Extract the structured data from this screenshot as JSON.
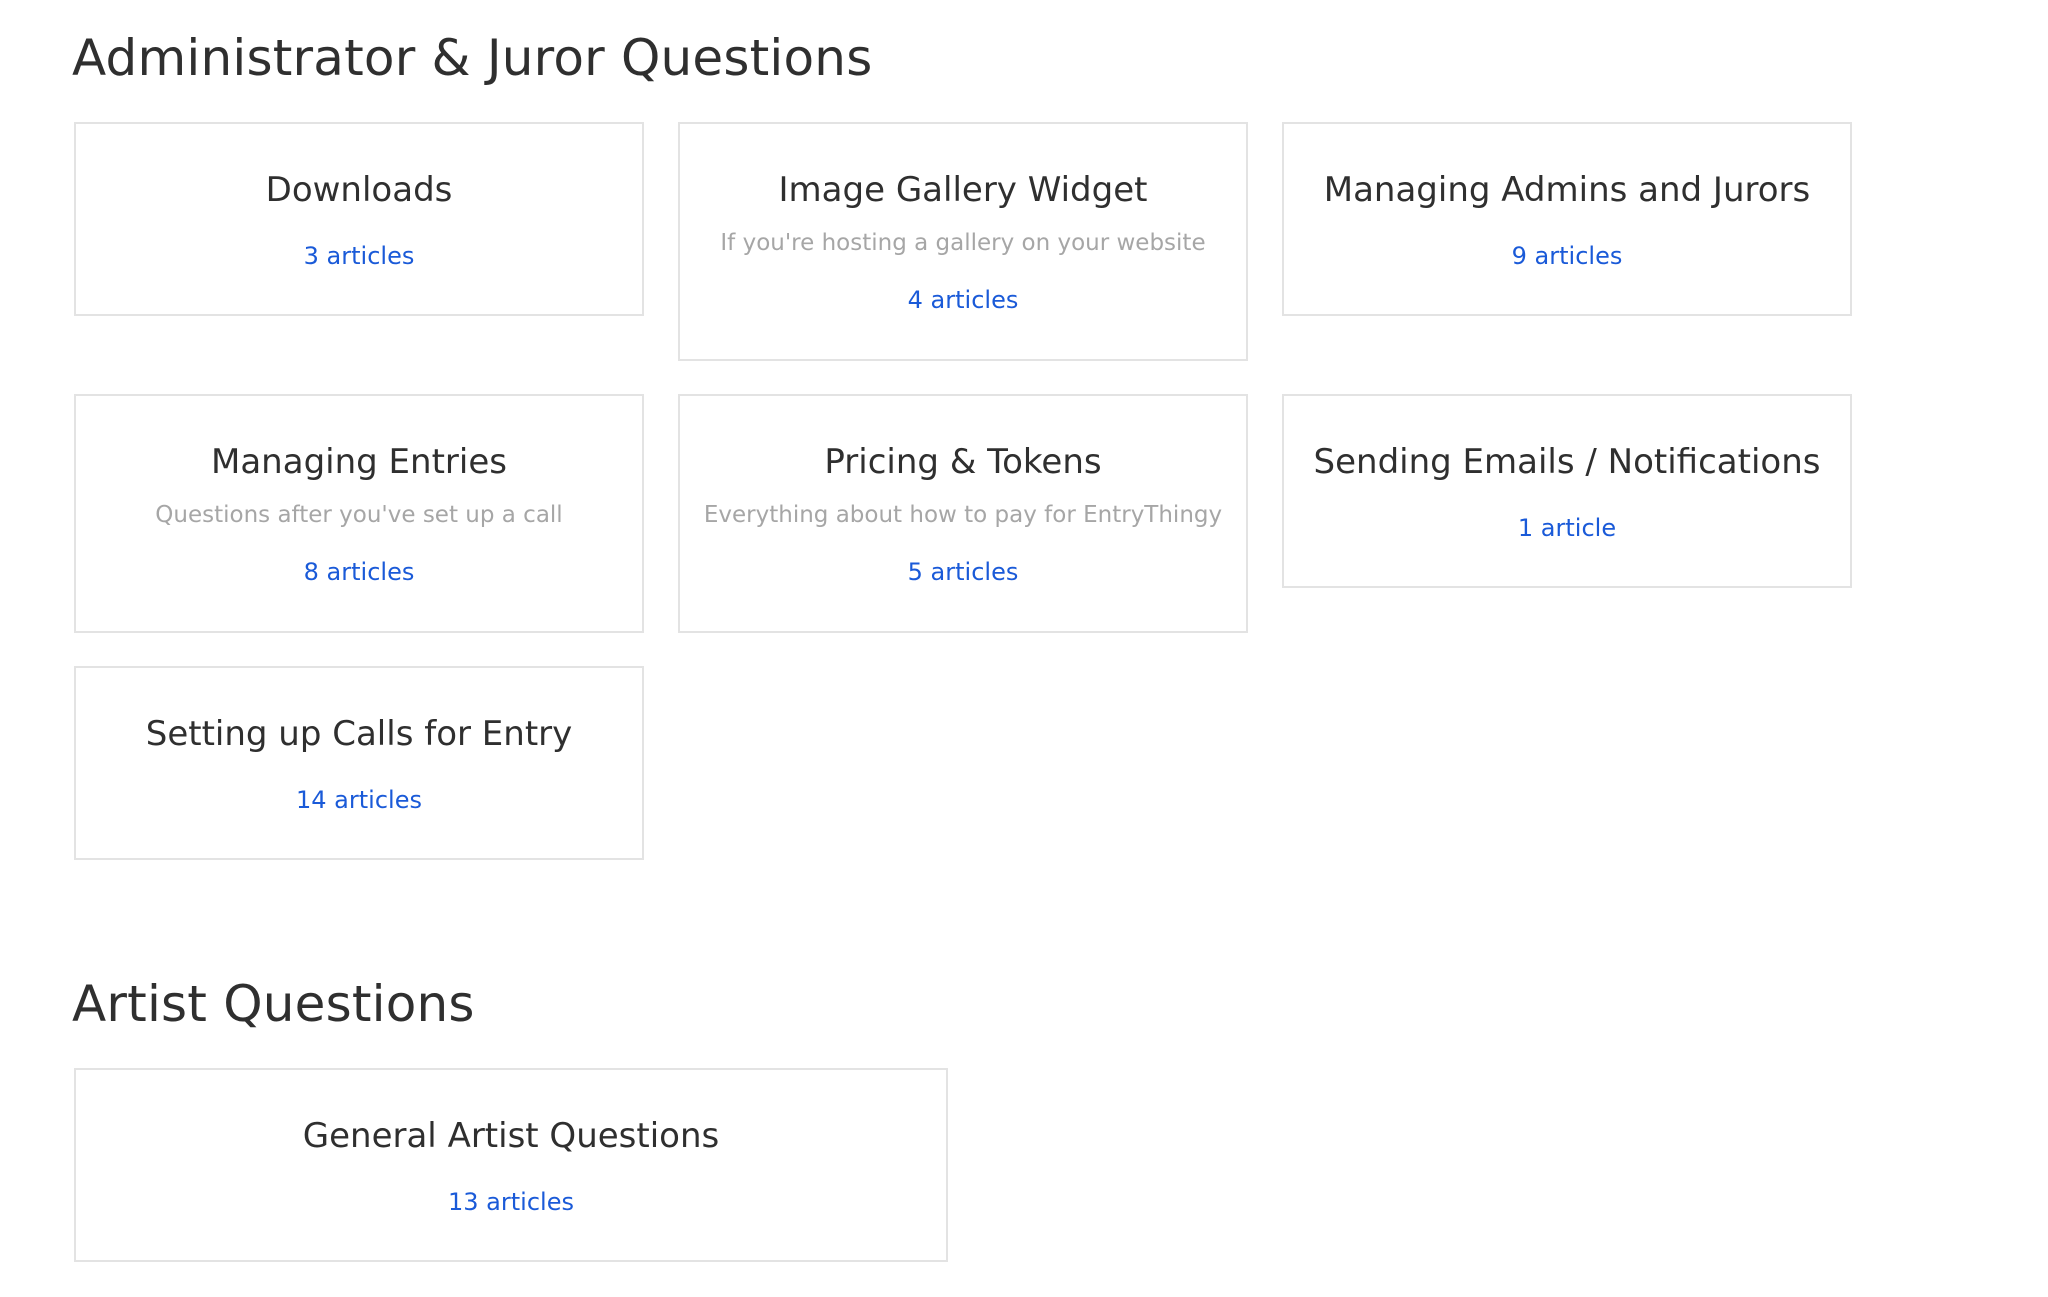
{
  "sections": [
    {
      "title": "Administrator & Juror Questions",
      "cards": [
        {
          "title": "Downloads",
          "description": "",
          "count": "3 articles"
        },
        {
          "title": "Image Gallery Widget",
          "description": "If you're hosting a gallery on your website",
          "count": "4 articles"
        },
        {
          "title": "Managing Admins and Jurors",
          "description": "",
          "count": "9 articles"
        },
        {
          "title": "Managing Entries",
          "description": "Questions after you've set up a call",
          "count": "8 articles"
        },
        {
          "title": "Pricing & Tokens",
          "description": "Everything about how to pay for EntryThingy",
          "count": "5 articles"
        },
        {
          "title": "Sending Emails / Notifications",
          "description": "",
          "count": "1 article"
        },
        {
          "title": "Setting up Calls for Entry",
          "description": "",
          "count": "14 articles"
        }
      ]
    },
    {
      "title": "Artist Questions",
      "cards": [
        {
          "title": "General Artist Questions",
          "description": "",
          "count": "13 articles"
        }
      ]
    }
  ],
  "colors": {
    "heading": "#2f2f2f",
    "description": "#a6a6a6",
    "link": "#1a5ad8",
    "border": "#e3e3e3"
  }
}
